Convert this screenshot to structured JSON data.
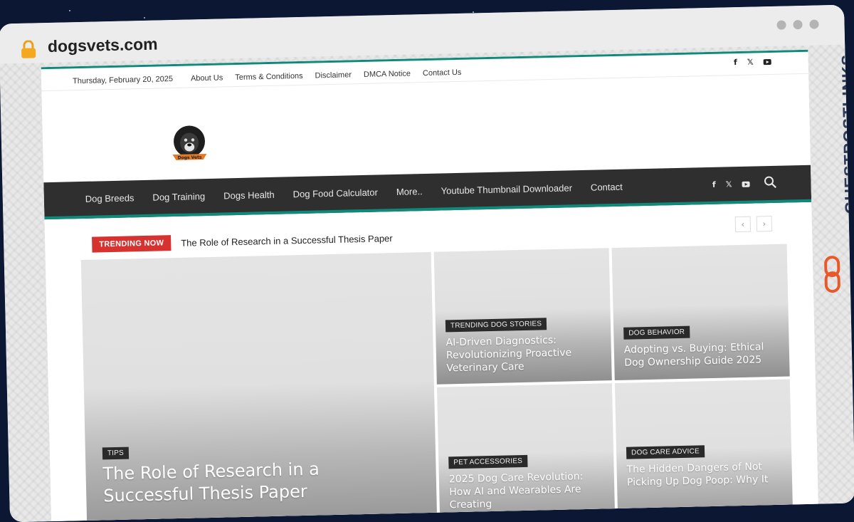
{
  "browser": {
    "url": "dogsvets.com",
    "lock_icon": "lock-icon",
    "window_dots": 3
  },
  "topbar": {
    "date": "Thursday, February 20, 2025",
    "links": [
      "About Us",
      "Terms & Conditions",
      "Disclaimer",
      "DMCA Notice",
      "Contact Us"
    ],
    "social": [
      "f",
      "𝕏"
    ]
  },
  "logo": {
    "text": "Dogs Vets"
  },
  "nav": {
    "items": [
      "Dog Breeds",
      "Dog Training",
      "Dogs Health",
      "Dog Food Calculator",
      "More..",
      "Youtube Thumbnail Downloader",
      "Contact"
    ],
    "social": [
      "f",
      "𝕏"
    ]
  },
  "trending": {
    "badge": "TRENDING NOW",
    "title": "The Role of Research in a Successful Thesis Paper",
    "prev": "‹",
    "next": "›"
  },
  "cards": [
    {
      "category": "TIPS",
      "title": "The Role of Research in a Successful Thesis Paper"
    },
    {
      "category": "TRENDING DOG STORIES",
      "title": "AI-Driven Diagnostics: Revolutionizing Proactive Veterinary Care"
    },
    {
      "category": "DOG BEHAVIOR",
      "title": "Adopting vs. Buying: Ethical Dog Ownership Guide 2025"
    },
    {
      "category": "PET ACCESSORIES",
      "title": "2025 Dog Care Revolution: How AI and Wearables Are Creating"
    },
    {
      "category": "DOG CARE ADVICE",
      "title": "The Hidden Dangers of Not Picking Up Dog Poop: Why It"
    }
  ],
  "watermark": {
    "text": "GUESTPOSTLINKS"
  },
  "colors": {
    "accent": "#0f8a7a",
    "nav_bg": "#2f2f2f",
    "trending_badge": "#d6322f",
    "space_bg": "#0b1733"
  }
}
